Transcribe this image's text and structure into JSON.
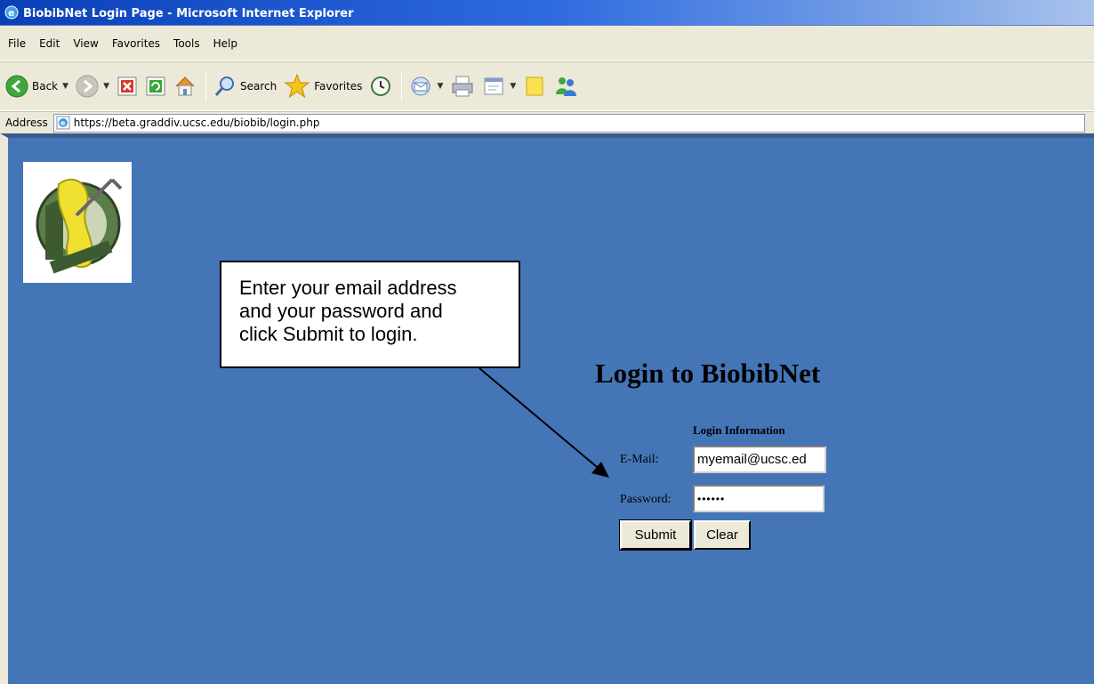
{
  "window": {
    "title": "BiobibNet Login Page - Microsoft Internet Explorer"
  },
  "menu": {
    "items": [
      "File",
      "Edit",
      "View",
      "Favorites",
      "Tools",
      "Help"
    ]
  },
  "toolbar": {
    "back_label": "Back",
    "search_label": "Search",
    "favorites_label": "Favorites"
  },
  "address": {
    "label": "Address",
    "url": "https://beta.graddiv.ucsc.edu/biobib/login.php"
  },
  "callout": {
    "lines": [
      "Enter your email address",
      "and your password and",
      "click Submit to login."
    ]
  },
  "login": {
    "title": "Login to BiobibNet",
    "section_heading": "Login Information",
    "email_label": "E-Mail:",
    "email_value": "myemail@ucsc.ed",
    "password_label": "Password:",
    "password_value": "••••••",
    "submit_label": "Submit",
    "clear_label": "Clear"
  },
  "colors": {
    "page_background": "#4476b7",
    "titlebar": "#0a3fb8",
    "chrome": "#ece9d8"
  },
  "icons": [
    "ie-icon",
    "back-icon",
    "forward-icon",
    "stop-icon",
    "refresh-icon",
    "home-icon",
    "search-icon",
    "favorites-icon",
    "history-icon",
    "mail-icon",
    "print-icon",
    "edit-icon",
    "notes-icon",
    "messenger-icon",
    "page-icon"
  ]
}
